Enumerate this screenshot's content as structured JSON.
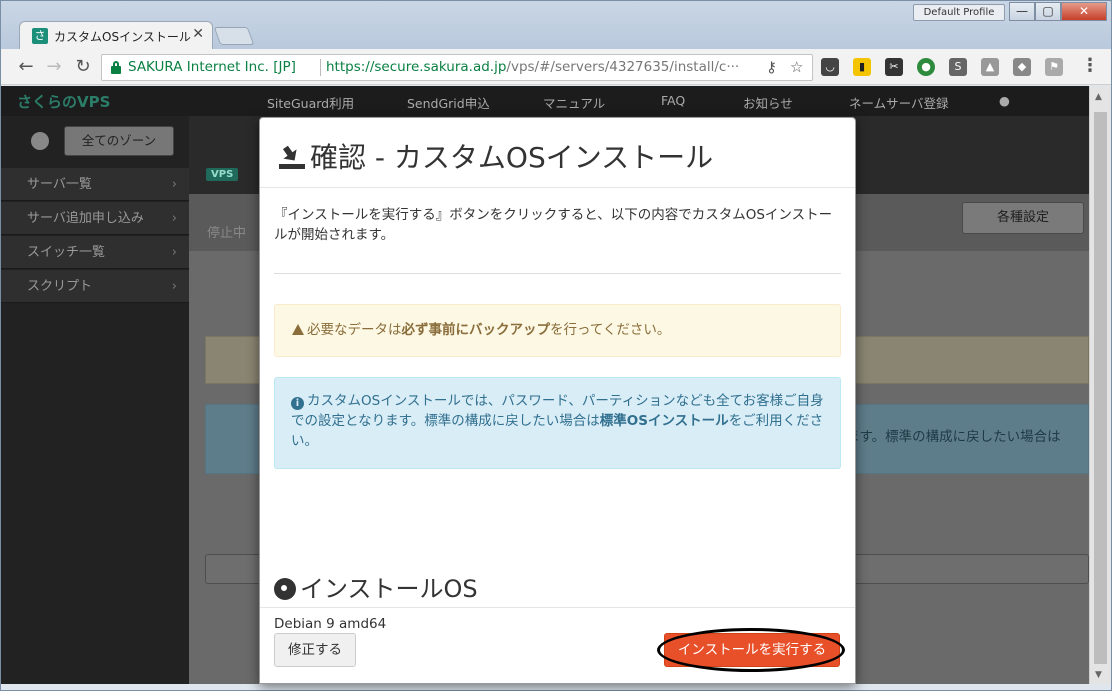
{
  "browser": {
    "tab_title": "カスタムOSインストール",
    "profile_label": "Default Profile",
    "site_identity": "SAKURA Internet Inc. [JP]",
    "url_host": "https://secure.sakura.ad.jp",
    "url_path": "/vps/#/servers/4327635/install/c···"
  },
  "background": {
    "logo": "さくらのVPS",
    "nav": [
      "SiteGuard利用",
      "SendGrid申込",
      "マニュアル",
      "FAQ",
      "お知らせ",
      "ネームサーバ登録"
    ],
    "zone_button": "全てのゾーン",
    "sidebar": [
      "サーバ一覧",
      "サーバ追加申し込み",
      "スイッチ一覧",
      "スクリプト"
    ],
    "vps_badge": "VPS",
    "status": "停止中",
    "settings_button": "各種設定",
    "info_fragment": "なります。標準の構成に戻したい場合は"
  },
  "modal": {
    "title": "確認 - カスタムOSインストール",
    "intro": "『インストールを実行する』ボタンをクリックすると、以下の内容でカスタムOSインストールが開始されます。",
    "warning_prefix": "必要なデータは",
    "warning_bold": "必ず事前にバックアップ",
    "warning_suffix": "を行ってください。",
    "info_part1": "カスタムOSインストールでは、パスワード、パーティションなども全てお客様ご自身での設定となります。標準の構成に戻したい場合は",
    "info_bold": "標準OSインストール",
    "info_part2": "をご利用ください。",
    "os_heading": "インストールOS",
    "os_value": "Debian 9 amd64",
    "fix_button": "修正する",
    "exec_button": "インストールを実行する"
  },
  "colors": {
    "exec_button": "#e8502a",
    "warning_bg": "#fcf8e3",
    "info_bg": "#d9edf7",
    "secure_green": "#0b8043"
  }
}
